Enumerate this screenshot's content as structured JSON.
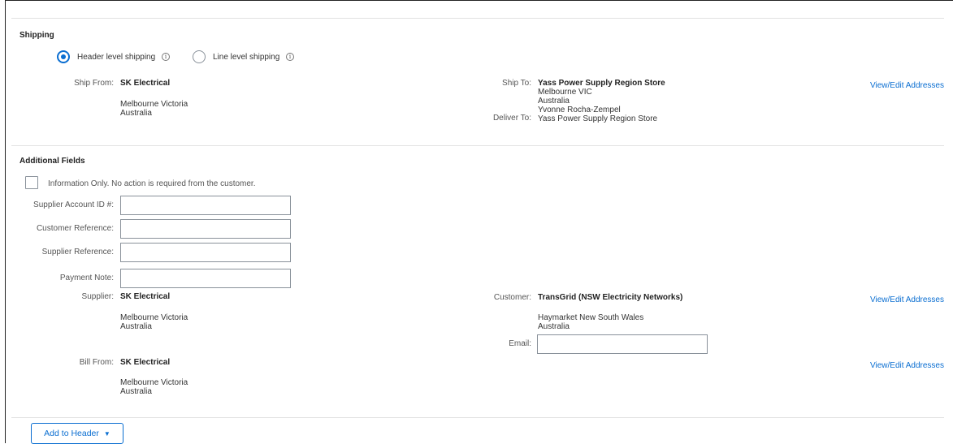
{
  "shipping": {
    "title": "Shipping",
    "options": [
      {
        "label": "Header level shipping",
        "selected": true
      },
      {
        "label": "Line level shipping",
        "selected": false
      }
    ],
    "info_glyph": "i",
    "ship_from": {
      "label": "Ship From:",
      "name": "SK Electrical",
      "line1": "Melbourne Victoria",
      "line2": "Australia"
    },
    "ship_to": {
      "label": "Ship To:",
      "name": "Yass Power Supply Region Store",
      "line1": "Melbourne VIC",
      "line2": "Australia"
    },
    "deliver_to": {
      "label": "Deliver To:",
      "line1": "Yvonne Rocha-Zempel",
      "line2": "Yass Power Supply Region Store"
    },
    "view_edit": "View/Edit Addresses"
  },
  "additional": {
    "title": "Additional Fields",
    "info_only": "Information Only. No action is required from the customer.",
    "fields": [
      {
        "label": "Supplier Account ID #:",
        "value": ""
      },
      {
        "label": "Customer Reference:",
        "value": ""
      },
      {
        "label": "Supplier Reference:",
        "value": ""
      },
      {
        "label": "Payment Note:",
        "value": ""
      }
    ],
    "supplier": {
      "label": "Supplier:",
      "name": "SK Electrical",
      "line1": "Melbourne Victoria",
      "line2": "Australia"
    },
    "customer": {
      "label": "Customer:",
      "name": "TransGrid (NSW Electricity Networks)",
      "line1": "Haymarket New South Wales",
      "line2": "Australia"
    },
    "email": {
      "label": "Email:",
      "value": ""
    },
    "bill_from": {
      "label": "Bill From:",
      "name": "SK Electrical",
      "line1": "Melbourne Victoria",
      "line2": "Australia"
    },
    "view_edit_1": "View/Edit Addresses",
    "view_edit_2": "View/Edit Addresses"
  },
  "footer": {
    "add_to_header": "Add to Header",
    "caret": "▼"
  },
  "colors": {
    "accent": "#0a6ed1",
    "border": "#89919a"
  }
}
